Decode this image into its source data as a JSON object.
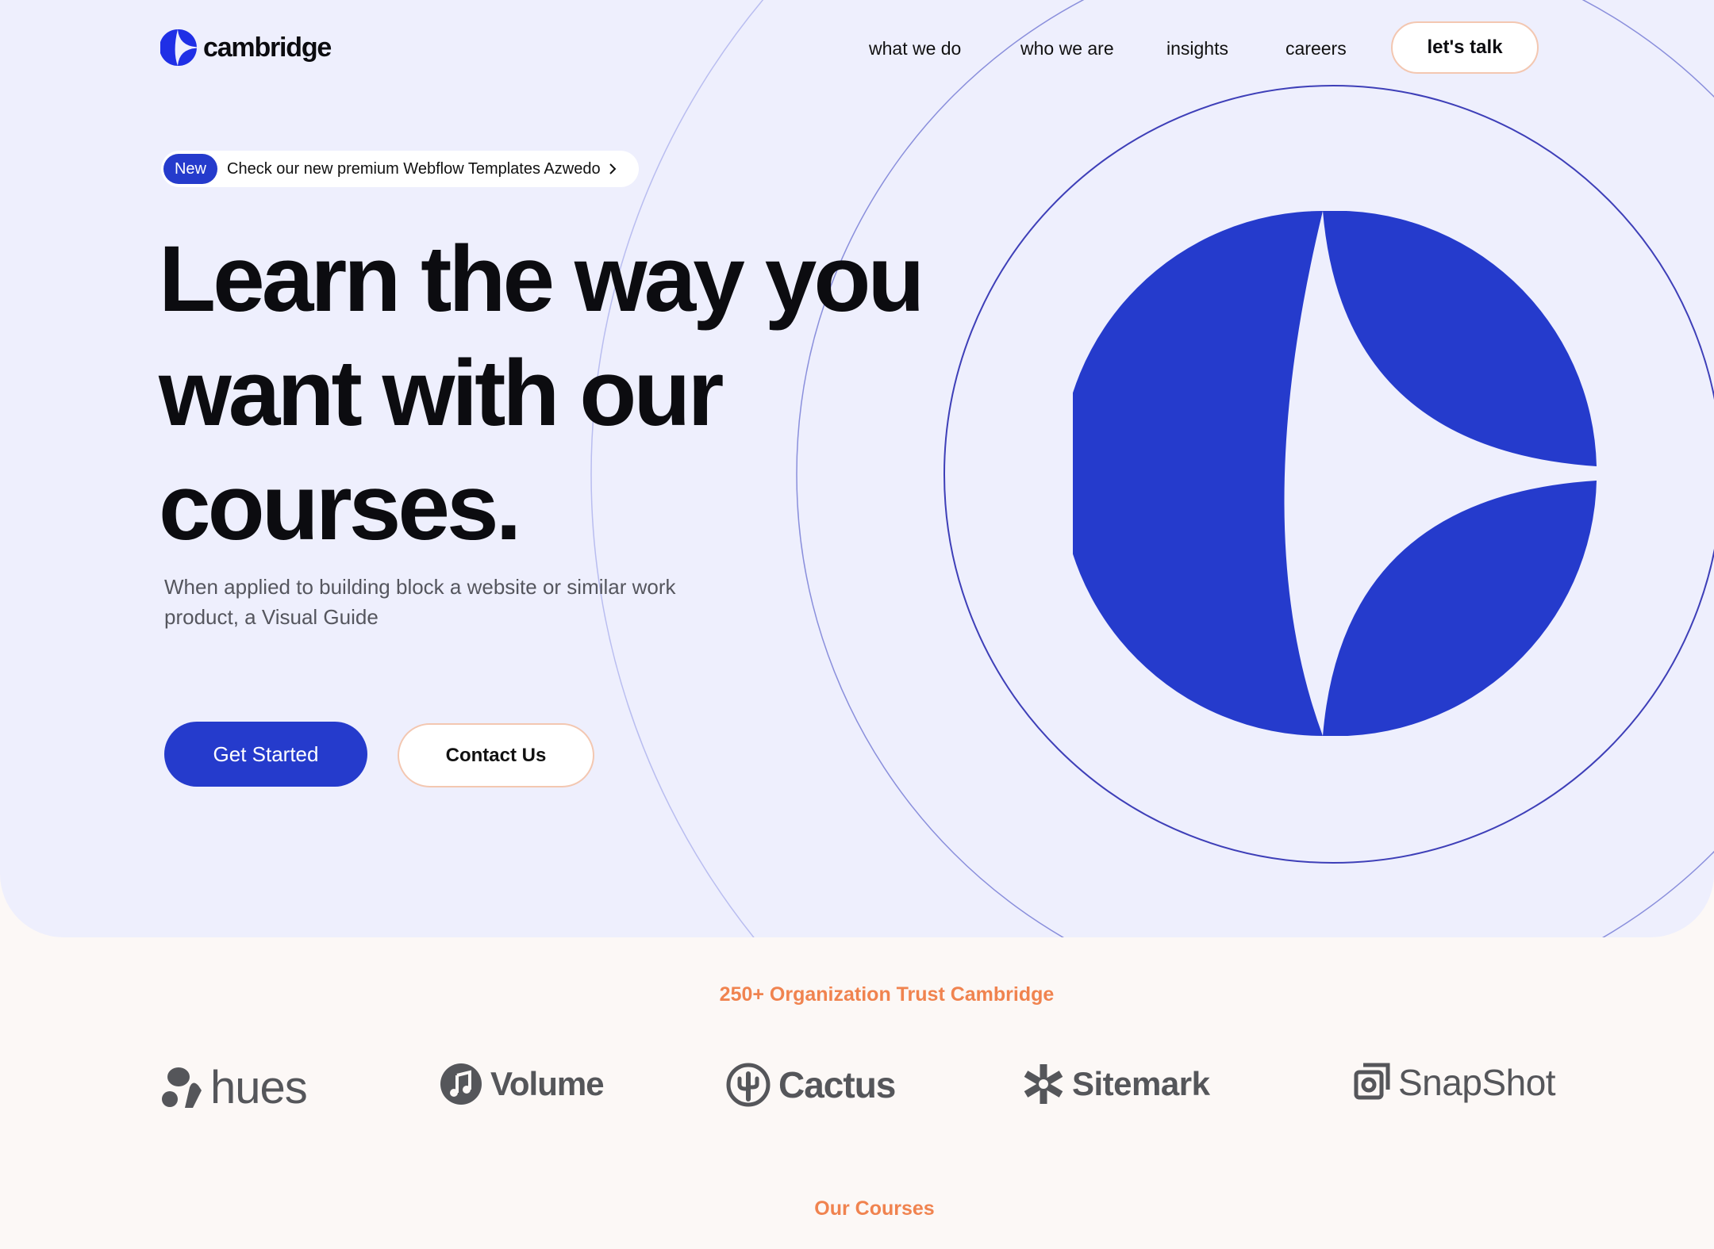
{
  "brand": {
    "name": "cambridge",
    "accent": "#253bcc",
    "secondary": "#f0834f"
  },
  "nav": {
    "items": [
      "what we do",
      "who we are",
      "insights",
      "careers"
    ],
    "cta": "let's talk"
  },
  "announcement": {
    "tag": "New",
    "text": "Check our new premium Webflow Templates Azwedo"
  },
  "hero": {
    "headline_lines": [
      "Learn the way you",
      "want with our",
      "courses."
    ],
    "subcopy": "When applied to building block a website or similar work product, a Visual Guide",
    "primary_button": "Get Started",
    "secondary_button": "Contact  Us"
  },
  "trust": {
    "heading": "250+ Organization Trust Cambridge",
    "logos": [
      {
        "name": "hues",
        "icon": "hues-blob-icon"
      },
      {
        "name": "Volume",
        "icon": "music-note-icon"
      },
      {
        "name": "Cactus",
        "icon": "cactus-icon"
      },
      {
        "name": "Sitemark",
        "icon": "asterisk-icon"
      },
      {
        "name": "SnapShot",
        "icon": "camera-frame-icon"
      }
    ]
  },
  "courses": {
    "heading": "Our Courses"
  }
}
